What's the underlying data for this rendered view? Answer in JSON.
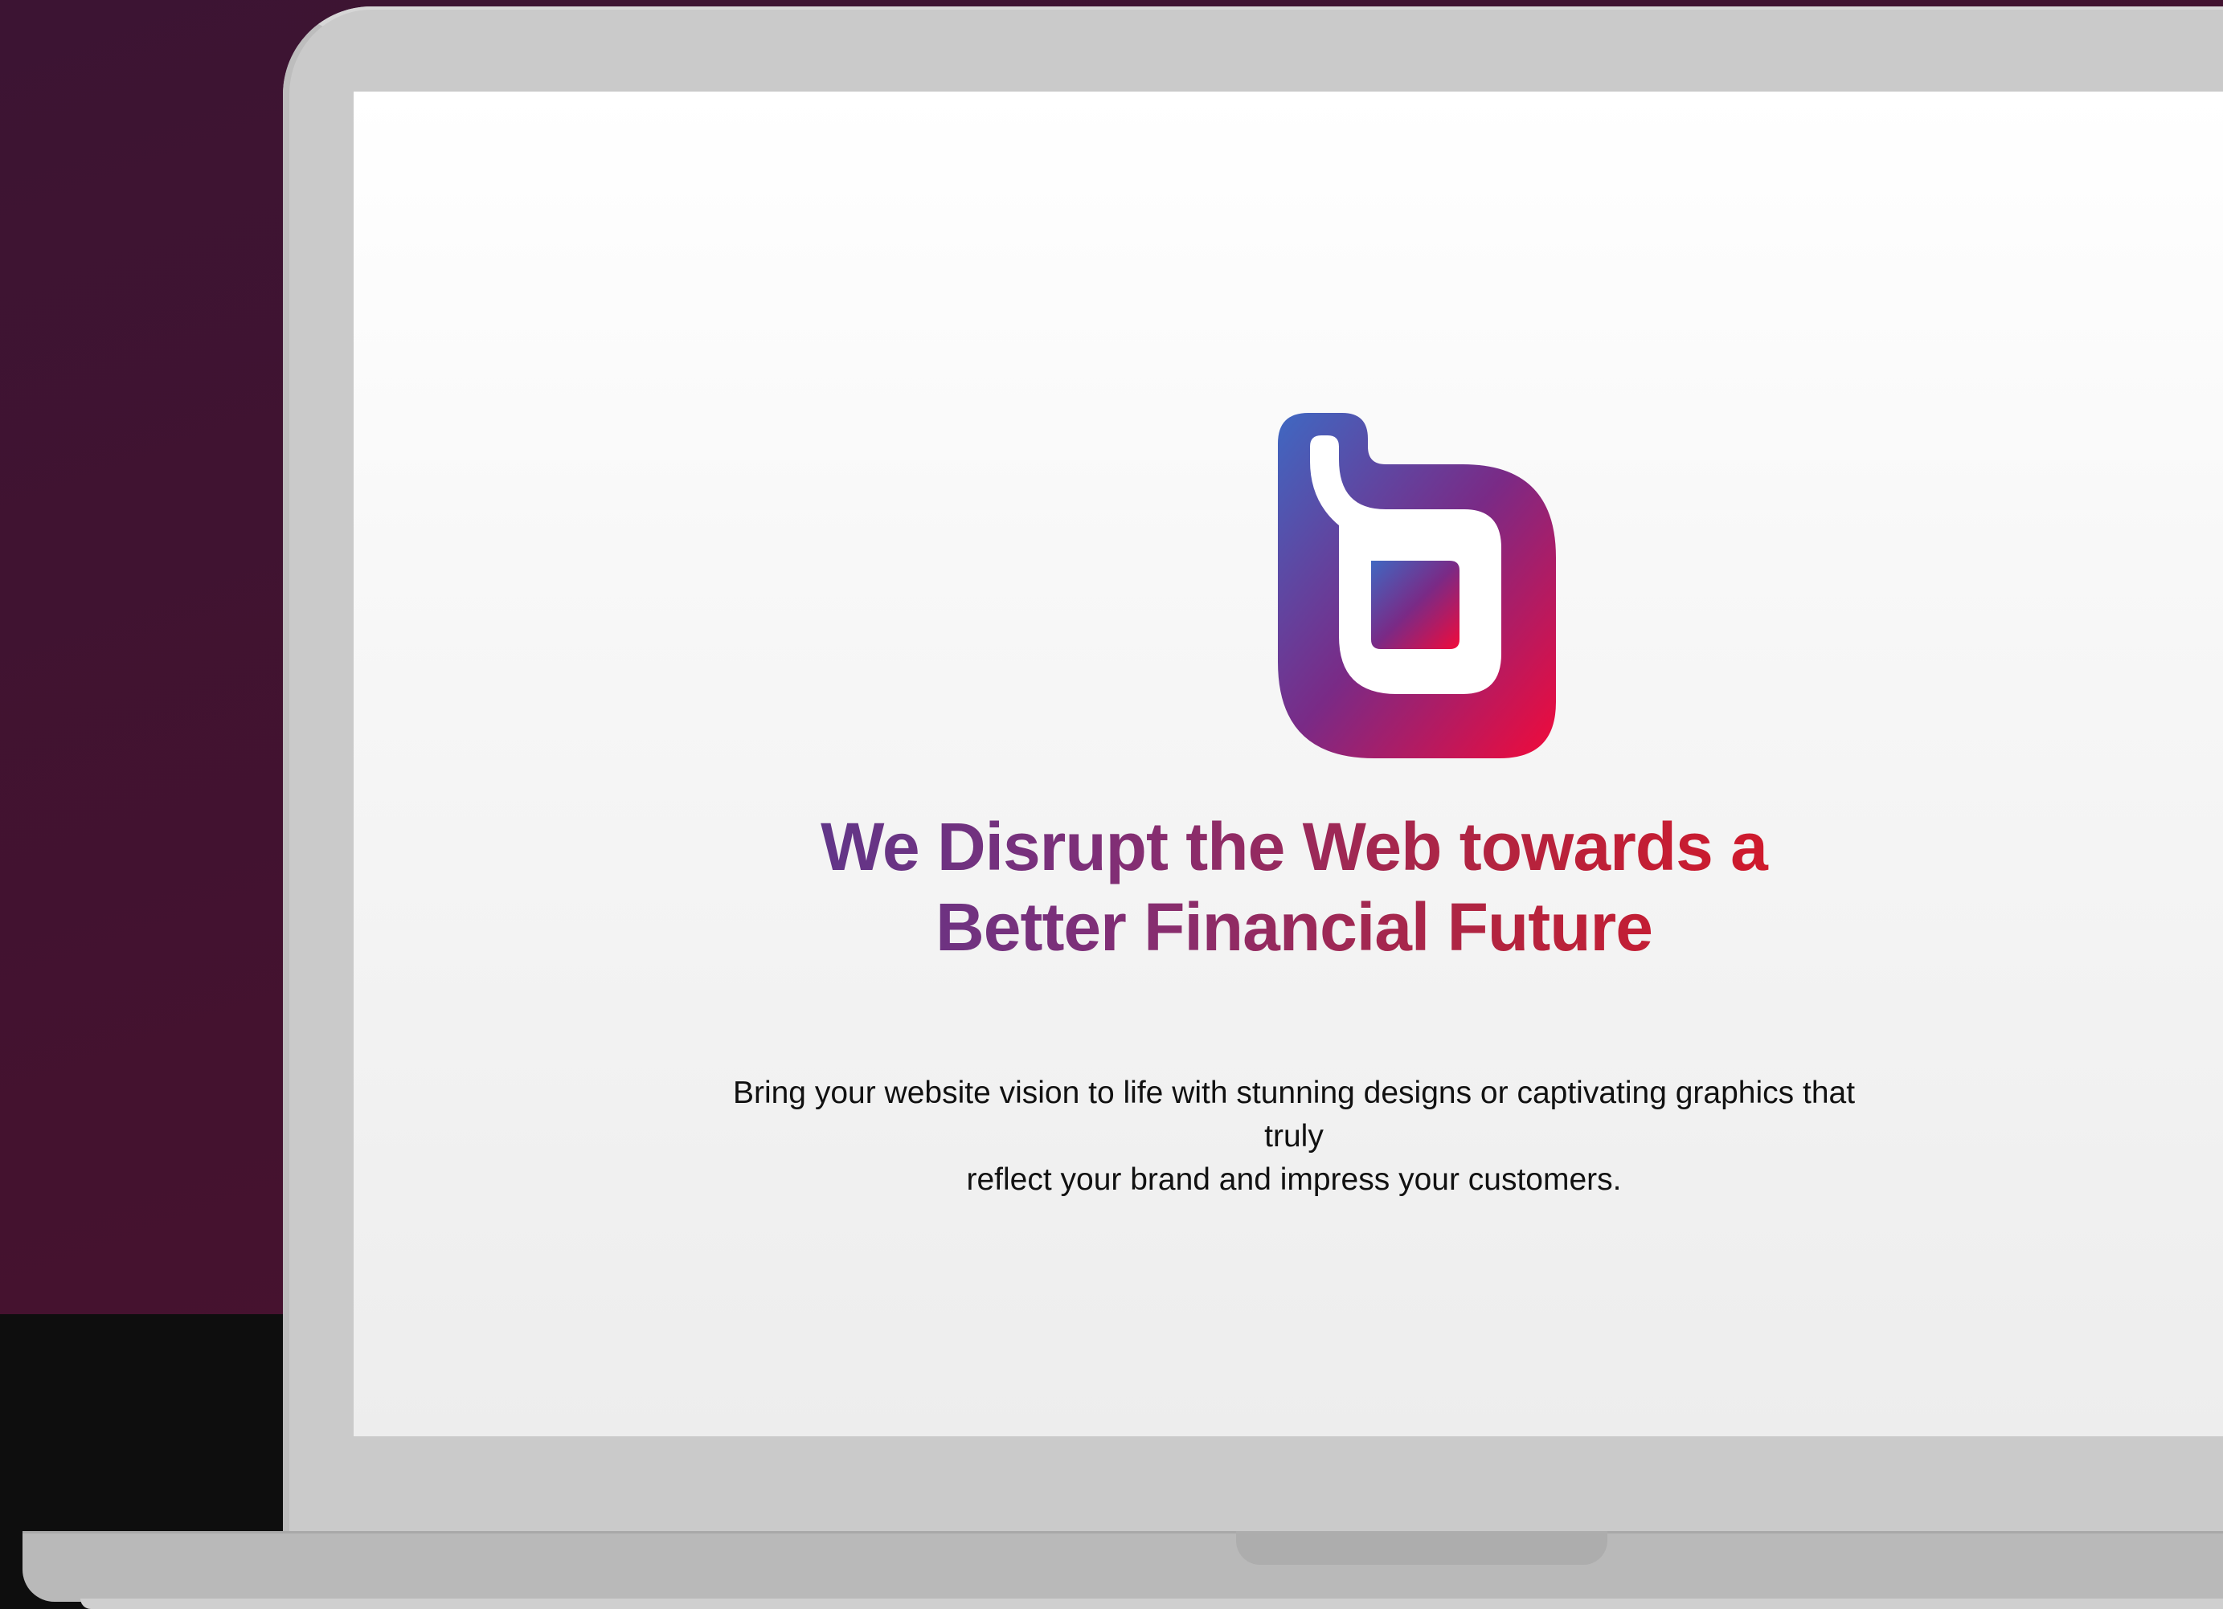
{
  "hero": {
    "headline_line1": "We Disrupt the Web towards a",
    "headline_line2": "Better Financial Future",
    "subtext_line1": "Bring your website vision to life with stunning designs or captivating graphics that truly",
    "subtext_line2": "reflect your brand and impress your customers."
  },
  "logo": {
    "icon": "b-logo-icon",
    "gradient_start": "#3f68c2",
    "gradient_mid": "#7a2a86",
    "gradient_end": "#f20a3a"
  },
  "colors": {
    "headline_gradient": [
      "#4d3a94",
      "#7e2f78",
      "#b3243f",
      "#e3121f"
    ],
    "backdrop": "#44122f",
    "laptop_frame": "#cacaca"
  }
}
